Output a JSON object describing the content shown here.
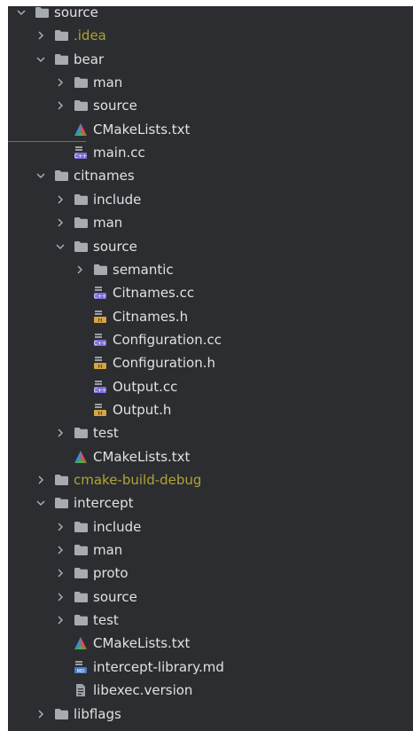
{
  "colors": {
    "panel_bg": "#2b2d30",
    "text": "#dfe1e5",
    "excluded_text": "#b0a434",
    "folder": "#a7abb1",
    "chevron": "#a9adb3"
  },
  "tree": [
    {
      "label": "source",
      "depth": 0,
      "type": "folder",
      "state": "expanded"
    },
    {
      "label": ".idea",
      "depth": 1,
      "type": "folder",
      "state": "collapsed",
      "color": "yellow"
    },
    {
      "label": "bear",
      "depth": 1,
      "type": "folder",
      "state": "expanded"
    },
    {
      "label": "man",
      "depth": 2,
      "type": "folder",
      "state": "collapsed"
    },
    {
      "label": "source",
      "depth": 2,
      "type": "folder",
      "state": "collapsed"
    },
    {
      "label": "CMakeLists.txt",
      "depth": 2,
      "type": "cmake-file"
    },
    {
      "label": "main.cc",
      "depth": 2,
      "type": "cpp-file"
    },
    {
      "label": "citnames",
      "depth": 1,
      "type": "folder",
      "state": "expanded"
    },
    {
      "label": "include",
      "depth": 2,
      "type": "folder",
      "state": "collapsed"
    },
    {
      "label": "man",
      "depth": 2,
      "type": "folder",
      "state": "collapsed"
    },
    {
      "label": "source",
      "depth": 2,
      "type": "folder",
      "state": "expanded"
    },
    {
      "label": "semantic",
      "depth": 3,
      "type": "folder",
      "state": "collapsed"
    },
    {
      "label": "Citnames.cc",
      "depth": 3,
      "type": "cpp-file"
    },
    {
      "label": "Citnames.h",
      "depth": 3,
      "type": "header-file"
    },
    {
      "label": "Configuration.cc",
      "depth": 3,
      "type": "cpp-file"
    },
    {
      "label": "Configuration.h",
      "depth": 3,
      "type": "header-file"
    },
    {
      "label": "Output.cc",
      "depth": 3,
      "type": "cpp-file"
    },
    {
      "label": "Output.h",
      "depth": 3,
      "type": "header-file"
    },
    {
      "label": "test",
      "depth": 2,
      "type": "folder",
      "state": "collapsed"
    },
    {
      "label": "CMakeLists.txt",
      "depth": 2,
      "type": "cmake-file"
    },
    {
      "label": "cmake-build-debug",
      "depth": 1,
      "type": "folder",
      "state": "collapsed",
      "color": "yellow"
    },
    {
      "label": "intercept",
      "depth": 1,
      "type": "folder",
      "state": "expanded"
    },
    {
      "label": "include",
      "depth": 2,
      "type": "folder",
      "state": "collapsed"
    },
    {
      "label": "man",
      "depth": 2,
      "type": "folder",
      "state": "collapsed"
    },
    {
      "label": "proto",
      "depth": 2,
      "type": "folder",
      "state": "collapsed"
    },
    {
      "label": "source",
      "depth": 2,
      "type": "folder",
      "state": "collapsed"
    },
    {
      "label": "test",
      "depth": 2,
      "type": "folder",
      "state": "collapsed"
    },
    {
      "label": "CMakeLists.txt",
      "depth": 2,
      "type": "cmake-file"
    },
    {
      "label": "intercept-library.md",
      "depth": 2,
      "type": "markdown-file"
    },
    {
      "label": "libexec.version",
      "depth": 2,
      "type": "text-file"
    },
    {
      "label": "libflags",
      "depth": 1,
      "type": "folder",
      "state": "collapsed"
    }
  ]
}
